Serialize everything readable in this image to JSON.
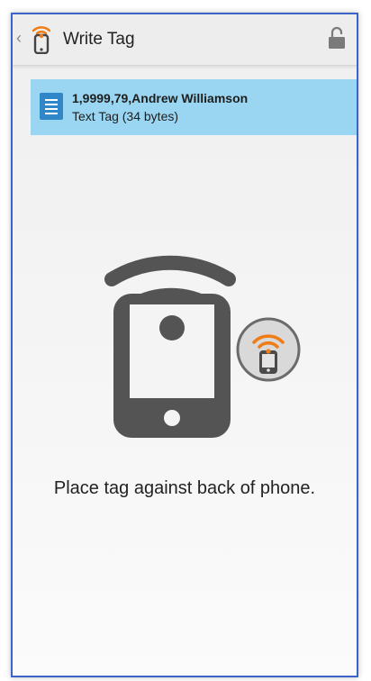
{
  "app_bar": {
    "title": "Write Tag",
    "back_icon": "back-chevron-icon",
    "app_icon": "nfc-phone-icon",
    "lock_icon": "lock-icon"
  },
  "tag": {
    "title": "1,9999,79,Andrew Williamson",
    "subtitle": "Text Tag (34 bytes)",
    "icon": "document-icon"
  },
  "instruction": "Place tag against back of phone.",
  "colors": {
    "accent_orange": "#f07c17",
    "card_background": "#9ad6f2",
    "doc_icon_blue": "#2f87c8",
    "illustration_gray": "#545454"
  }
}
